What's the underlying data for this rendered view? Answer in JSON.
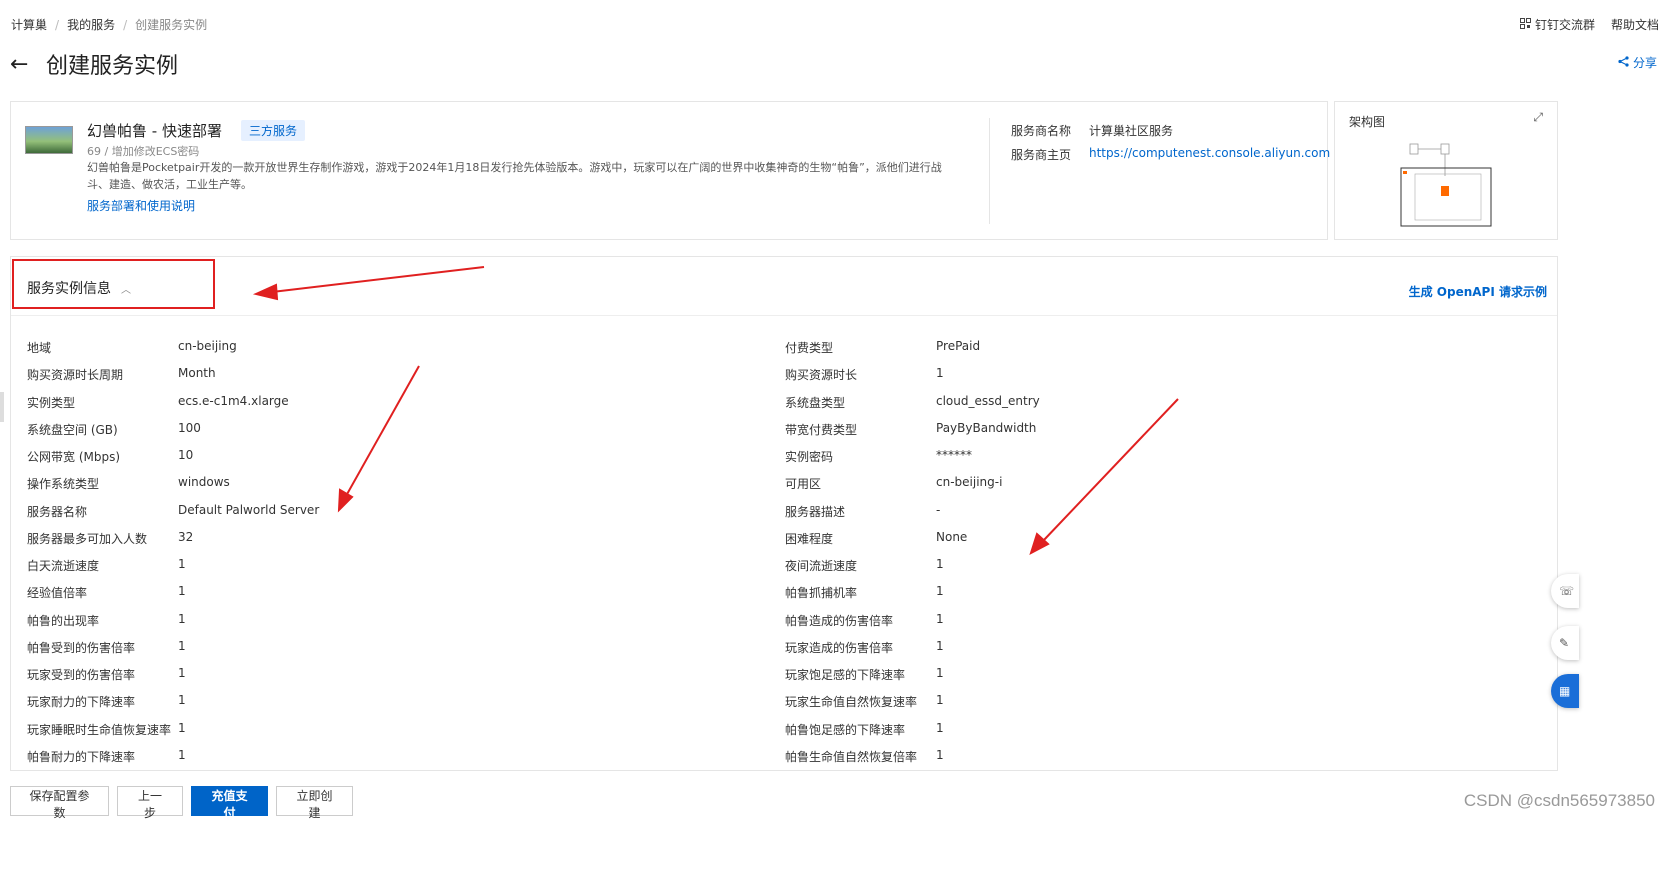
{
  "breadcrumb": [
    "计算巢",
    "我的服务",
    "创建服务实例"
  ],
  "breadcrumb_sep": "/",
  "top_links": {
    "dingtalk": "钉钉交流群",
    "help": "帮助文档"
  },
  "page": {
    "title": "创建服务实例",
    "share": "分享"
  },
  "service": {
    "name": "幻兽帕鲁 - 快速部署",
    "badge": "三方服务",
    "version": "69 / 增加修改ECS密码",
    "description": "幻兽帕鲁是Pocketpair开发的一款开放世界生存制作游戏，游戏于2024年1月18日发行抢先体验版本。游戏中，玩家可以在广阔的世界中收集神奇的生物“帕鲁”，派他们进行战斗、建造、做农活，工业生产等。",
    "doc_link": "服务部署和使用说明",
    "provider_name_label": "服务商名称",
    "provider_name": "计算巢社区服务",
    "provider_home_label": "服务商主页",
    "provider_home": "https://computenest.console.aliyun.com"
  },
  "architecture": {
    "title": "架构图"
  },
  "info": {
    "title": "服务实例信息",
    "openapi": "生成 OpenAPI 请求示例",
    "left": [
      {
        "k": "地域",
        "v": "cn-beijing"
      },
      {
        "k": "购买资源时长周期",
        "v": "Month"
      },
      {
        "k": "实例类型",
        "v": "ecs.e-c1m4.xlarge"
      },
      {
        "k": "系统盘空间 (GB)",
        "v": "100"
      },
      {
        "k": "公网带宽 (Mbps)",
        "v": "10"
      },
      {
        "k": "操作系统类型",
        "v": "windows"
      },
      {
        "k": "服务器名称",
        "v": "Default Palworld Server"
      },
      {
        "k": "服务器最多可加入人数",
        "v": "32"
      },
      {
        "k": "白天流逝速度",
        "v": "1"
      },
      {
        "k": "经验值倍率",
        "v": "1"
      },
      {
        "k": "帕鲁的出现率",
        "v": "1"
      },
      {
        "k": "帕鲁受到的伤害倍率",
        "v": "1"
      },
      {
        "k": "玩家受到的伤害倍率",
        "v": "1"
      },
      {
        "k": "玩家耐力的下降速率",
        "v": "1"
      },
      {
        "k": "玩家睡眠时生命值恢复速率",
        "v": "1"
      },
      {
        "k": "帕鲁耐力的下降速率",
        "v": "1"
      }
    ],
    "right": [
      {
        "k": "付费类型",
        "v": "PrePaid"
      },
      {
        "k": "购买资源时长",
        "v": "1"
      },
      {
        "k": "系统盘类型",
        "v": "cloud_essd_entry"
      },
      {
        "k": "带宽付费类型",
        "v": "PayByBandwidth"
      },
      {
        "k": "实例密码",
        "v": "******"
      },
      {
        "k": "可用区",
        "v": "cn-beijing-i"
      },
      {
        "k": "服务器描述",
        "v": "-"
      },
      {
        "k": "困难程度",
        "v": "None"
      },
      {
        "k": "夜间流逝速度",
        "v": "1"
      },
      {
        "k": "帕鲁抓捕机率",
        "v": "1"
      },
      {
        "k": "帕鲁造成的伤害倍率",
        "v": "1"
      },
      {
        "k": "玩家造成的伤害倍率",
        "v": "1"
      },
      {
        "k": "玩家饱足感的下降速率",
        "v": "1"
      },
      {
        "k": "玩家生命值自然恢复速率",
        "v": "1"
      },
      {
        "k": "帕鲁饱足感的下降速率",
        "v": "1"
      },
      {
        "k": "帕鲁生命值自然恢复倍率",
        "v": "1"
      }
    ]
  },
  "buttons": {
    "save": "保存配置参数",
    "prev": "上一步",
    "pay": "充值支付",
    "create": "立即创建"
  },
  "watermark": "CSDN @csdn565973850",
  "colors": {
    "accent": "#0064c8",
    "link": "#0066cc",
    "annotation": "#e02020"
  }
}
